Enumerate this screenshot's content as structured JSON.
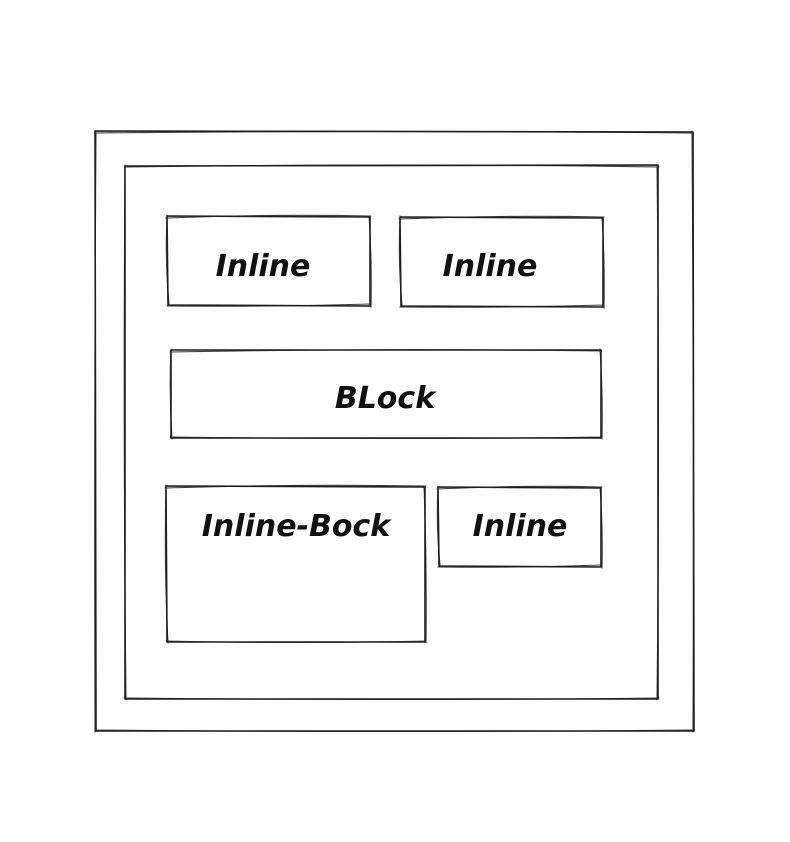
{
  "diagram": {
    "boxes": {
      "inline_1": "Inline",
      "inline_2": "Inline",
      "block": "BLock",
      "inline_block": "Inline-Bock",
      "inline_3": "Inline"
    }
  }
}
